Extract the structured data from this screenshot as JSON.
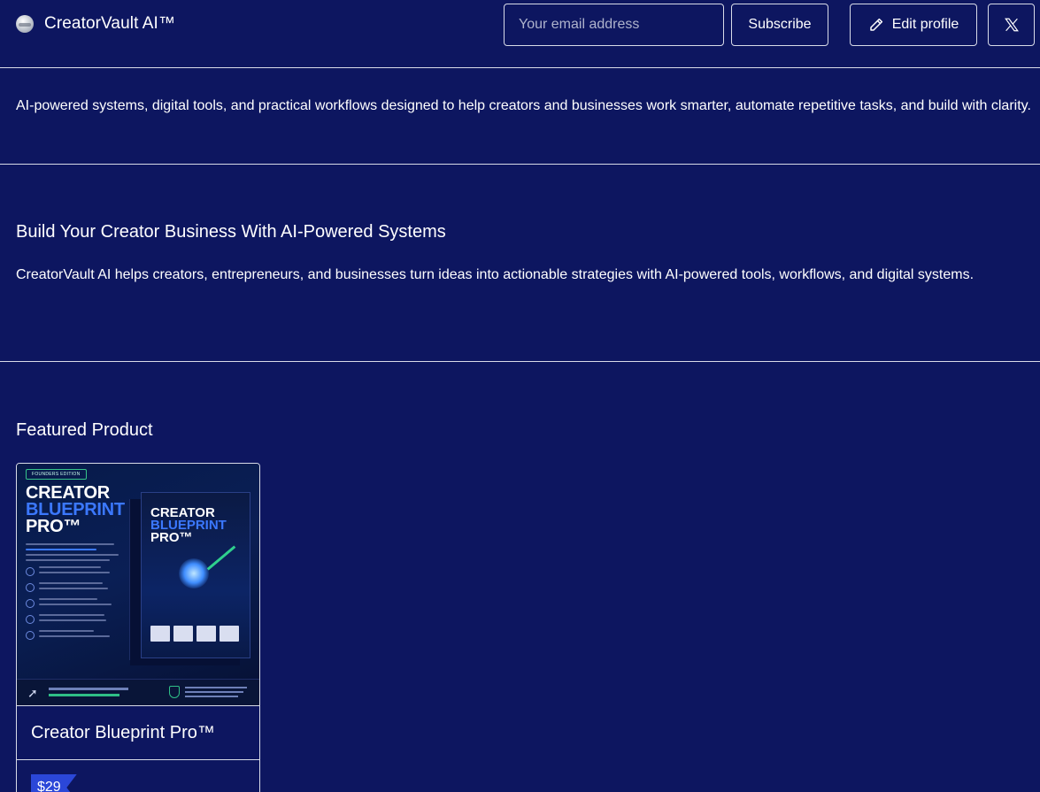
{
  "header": {
    "brand_name": "CreatorVault AI™",
    "email_placeholder": "Your email address",
    "subscribe_label": "Subscribe",
    "edit_profile_label": "Edit profile",
    "x_icon": "x-logo-icon"
  },
  "intro": {
    "text": "AI-powered systems, digital tools, and practical workflows designed to help creators and businesses work smarter, automate repetitive tasks, and build with clarity."
  },
  "hero": {
    "heading": "Build Your Creator Business With AI-Powered Systems",
    "text": "CreatorVault AI helps creators, entrepreneurs, and businesses turn ideas into actionable strategies with AI-powered tools, workflows, and digital systems."
  },
  "featured": {
    "title": "Featured Product",
    "product": {
      "name": "Creator Blueprint Pro™",
      "price": "$29",
      "image": {
        "badge": "FOUNDERS EDITION",
        "title_line1": "CREATOR",
        "title_line2": "BLUEPRINT",
        "title_line3": "PRO™"
      }
    }
  },
  "colors": {
    "background": "#0d1660",
    "border": "#d8dbe8",
    "accent_blue": "#3b78ff",
    "price_tag": "#2b47d8",
    "accent_green": "#2fd08d"
  }
}
